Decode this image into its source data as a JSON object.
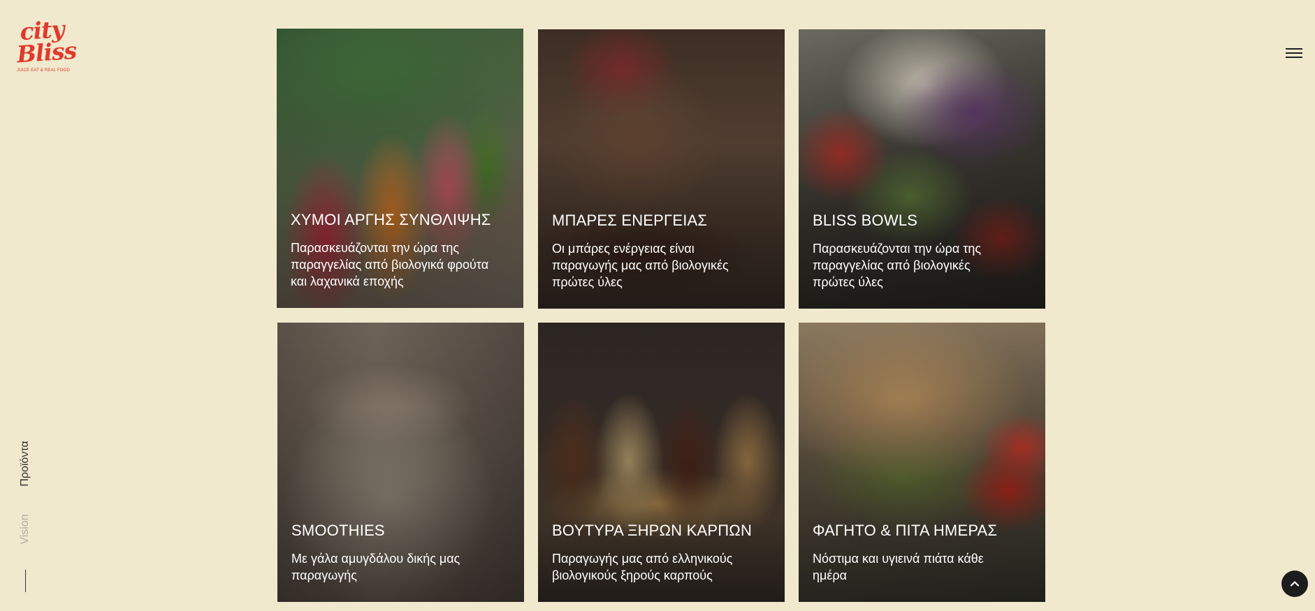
{
  "logo": {
    "line1": "city",
    "line2": "Bliss",
    "tagline": "JUICE EAT & REAL FOOD"
  },
  "header": {
    "menu_icon": "hamburger-menu-icon"
  },
  "side_nav": {
    "items": [
      {
        "label": "Προϊόντα",
        "active": true
      },
      {
        "label": "Vision",
        "active": false
      }
    ]
  },
  "products": [
    {
      "title": "ΧΥΜΟΙ ΑΡΓΗΣ ΣΥΝΘΛΙΨΗΣ",
      "description": "Παρασκευάζονται την ώρα της παραγγελίας από βιολογικά φρούτα και λαχανικά εποχής"
    },
    {
      "title": "ΜΠΑΡΕΣ ΕΝΕΡΓΕΙΑΣ",
      "description": "Οι μπάρες ενέργειας είναι παραγωγής μας από βιολογικές πρώτες ύλες"
    },
    {
      "title": "BLISS BOWLS",
      "description": "Παρασκευάζονται την ώρα της παραγγελίας από βιολογικές πρώτες ύλες"
    },
    {
      "title": "SMOOTHIES",
      "description": "Με γάλα αμυγδάλου δικής μας παραγωγής"
    },
    {
      "title": "ΒΟΥΤΥΡΑ ΞΗΡΩΝ ΚΑΡΠΩΝ",
      "description": "Παραγωγής μας από ελληνικούς βιολογικούς ξηρούς καρπούς"
    },
    {
      "title": "ΦΑΓΗΤΟ & ΠΙΤΑ ΗΜΕΡΑΣ",
      "description": "Νόστιμα και υγιεινά πιάτα κάθε ημέρα"
    }
  ],
  "back_to_top": {
    "icon": "chevron-up-icon"
  },
  "colors": {
    "background": "#f1e9ce",
    "brand": "#e0392b",
    "text_dark": "#333333",
    "text_muted": "#b3ad9f"
  }
}
